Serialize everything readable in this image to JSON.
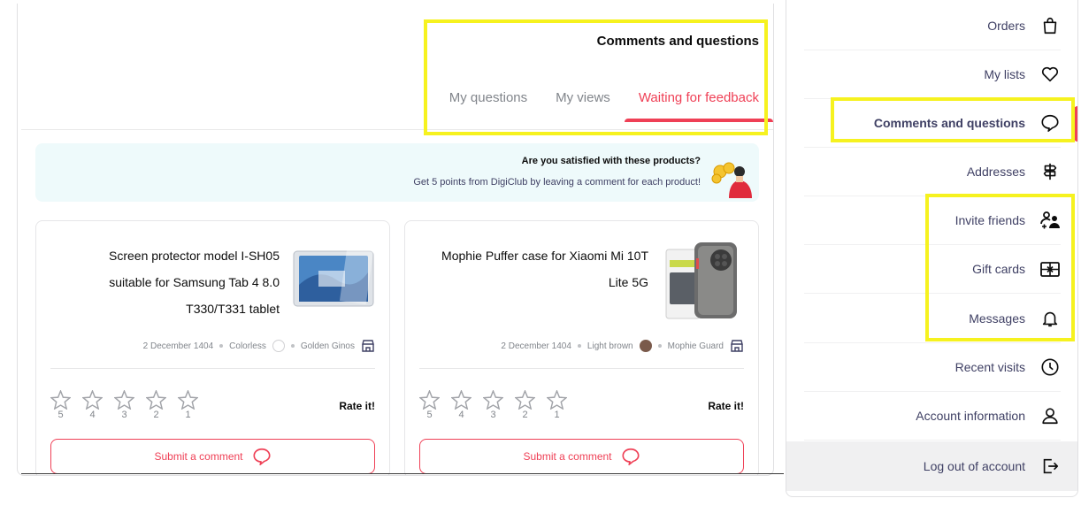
{
  "header": {
    "title": "Comments and questions",
    "tabs": [
      {
        "label": "My questions",
        "active": false
      },
      {
        "label": "My views",
        "active": false
      },
      {
        "label": "Waiting for feedback",
        "active": true
      }
    ]
  },
  "banner": {
    "title": "Are you satisfied with these products?",
    "subtitle": "Get 5 points from DigiClub by leaving a comment for each product!"
  },
  "products": [
    {
      "name": "Screen protector model I-SH05 suitable for Samsung Tab 4 8.0 T330/T331 tablet",
      "date": "2 December 1404",
      "color_name": "Colorless",
      "color_hex": "#ffffff",
      "seller": "Golden Ginos",
      "stars": [
        "5",
        "4",
        "3",
        "2",
        "1"
      ],
      "rate_label": "Rate it!",
      "submit_label": "Submit a comment"
    },
    {
      "name": "Mophie Puffer case for Xiaomi Mi 10T Lite 5G",
      "date": "2 December 1404",
      "color_name": "Light brown",
      "color_hex": "#7a5a4b",
      "seller": "Mophie Guard",
      "stars": [
        "5",
        "4",
        "3",
        "2",
        "1"
      ],
      "rate_label": "Rate it!",
      "submit_label": "Submit a comment"
    }
  ],
  "sidebar": {
    "items": [
      {
        "label": "Orders",
        "icon": "shopping-bag-icon"
      },
      {
        "label": "My lists",
        "icon": "heart-icon"
      },
      {
        "label": "Comments and questions",
        "icon": "speech-bubble-icon",
        "active": true
      },
      {
        "label": "Addresses",
        "icon": "signpost-icon"
      },
      {
        "label": "Invite friends",
        "icon": "invite-friends-icon"
      },
      {
        "label": "Gift cards",
        "icon": "gift-card-icon"
      },
      {
        "label": "Messages",
        "icon": "bell-icon"
      },
      {
        "label": "Recent visits",
        "icon": "clock-icon"
      },
      {
        "label": "Account information",
        "icon": "user-icon"
      },
      {
        "label": "Log out of account",
        "icon": "logout-icon"
      }
    ]
  },
  "colors": {
    "accent": "#ef4056",
    "highlight": "#f6f21f",
    "banner_bg": "#eefafb",
    "text_primary": "#3f4064"
  }
}
